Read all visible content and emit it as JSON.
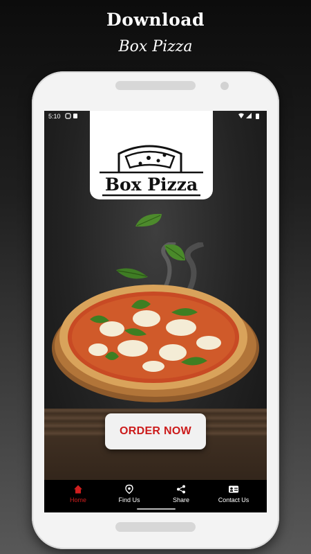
{
  "promo": {
    "line1": "Download",
    "line2": "Box Pizza"
  },
  "status_bar": {
    "time": "5:10"
  },
  "logo": {
    "text": "Box Pizza"
  },
  "order_button": {
    "label": "ORDER NOW"
  },
  "nav": {
    "items": [
      {
        "label": "Home",
        "icon": "home-icon",
        "active": true
      },
      {
        "label": "Find Us",
        "icon": "location-pin-icon",
        "active": false
      },
      {
        "label": "Share",
        "icon": "share-icon",
        "active": false
      },
      {
        "label": "Contact Us",
        "icon": "contact-card-icon",
        "active": false
      }
    ]
  },
  "colors": {
    "accent": "#cc1b1b",
    "nav_bg": "#000000",
    "button_bg": "#f1f1f1"
  }
}
